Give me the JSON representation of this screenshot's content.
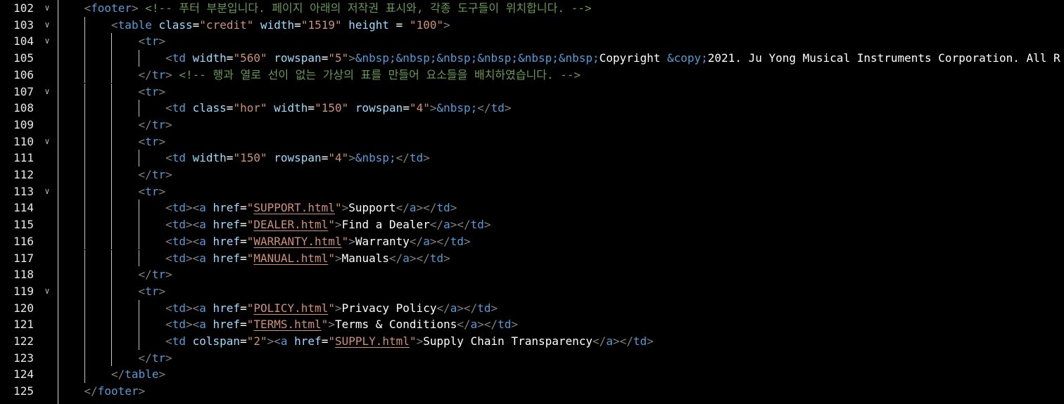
{
  "editor": {
    "colors": {
      "background": "#000000",
      "tag": "#569cd6",
      "attr": "#9cdcfe",
      "string": "#ce9178",
      "comment": "#6a9955",
      "punct": "#808080",
      "text": "#ffffff"
    },
    "lines": [
      {
        "num": "102",
        "fold": true,
        "indent": 1,
        "tokens": [
          [
            "punc",
            "<"
          ],
          [
            "tag",
            "footer"
          ],
          [
            "punc",
            ">"
          ],
          [
            "text",
            " "
          ],
          [
            "com",
            "<!-- 푸터 부분입니다. 페이지 아래의 저작권 표시와, 각종 도구들이 위치합니다. -->"
          ]
        ]
      },
      {
        "num": "103",
        "fold": true,
        "indent": 2,
        "tokens": [
          [
            "punc",
            "<"
          ],
          [
            "tag",
            "table"
          ],
          [
            "text",
            " "
          ],
          [
            "attr",
            "class"
          ],
          [
            "text",
            "="
          ],
          [
            "str",
            "\"credit\""
          ],
          [
            "text",
            " "
          ],
          [
            "attr",
            "width"
          ],
          [
            "text",
            "="
          ],
          [
            "str",
            "\"1519\""
          ],
          [
            "text",
            " "
          ],
          [
            "attr",
            "height"
          ],
          [
            "text",
            " = "
          ],
          [
            "str",
            "\"100\""
          ],
          [
            "punc",
            ">"
          ]
        ]
      },
      {
        "num": "104",
        "fold": true,
        "indent": 3,
        "tokens": [
          [
            "punc",
            "<"
          ],
          [
            "tag",
            "tr"
          ],
          [
            "punc",
            ">"
          ]
        ]
      },
      {
        "num": "105",
        "fold": false,
        "indent": 4,
        "tokens": [
          [
            "punc",
            "<"
          ],
          [
            "tag",
            "td"
          ],
          [
            "text",
            " "
          ],
          [
            "attr",
            "width"
          ],
          [
            "text",
            "="
          ],
          [
            "str",
            "\"560\""
          ],
          [
            "text",
            " "
          ],
          [
            "attr",
            "rowspan"
          ],
          [
            "text",
            "="
          ],
          [
            "str",
            "\"5\""
          ],
          [
            "punc",
            ">"
          ],
          [
            "ent",
            "&nbsp;&nbsp;&nbsp;&nbsp;&nbsp;&nbsp;"
          ],
          [
            "text",
            "Copyright "
          ],
          [
            "ent",
            "&copy;"
          ],
          [
            "text",
            "2021. Ju Yong Musical Instruments Corporation. All R"
          ]
        ]
      },
      {
        "num": "106",
        "fold": false,
        "indent": 3,
        "tokens": [
          [
            "punc",
            "</"
          ],
          [
            "tag",
            "tr"
          ],
          [
            "punc",
            ">"
          ],
          [
            "text",
            " "
          ],
          [
            "com",
            "<!-- 행과 열로 선이 없는 가상의 표를 만들어 요소들을 배치하였습니다. -->"
          ]
        ]
      },
      {
        "num": "107",
        "fold": true,
        "indent": 3,
        "tokens": [
          [
            "punc",
            "<"
          ],
          [
            "tag",
            "tr"
          ],
          [
            "punc",
            ">"
          ]
        ]
      },
      {
        "num": "108",
        "fold": false,
        "indent": 4,
        "tokens": [
          [
            "punc",
            "<"
          ],
          [
            "tag",
            "td"
          ],
          [
            "text",
            " "
          ],
          [
            "attr",
            "class"
          ],
          [
            "text",
            "="
          ],
          [
            "str",
            "\"hor\""
          ],
          [
            "text",
            " "
          ],
          [
            "attr",
            "width"
          ],
          [
            "text",
            "="
          ],
          [
            "str",
            "\"150\""
          ],
          [
            "text",
            " "
          ],
          [
            "attr",
            "rowspan"
          ],
          [
            "text",
            "="
          ],
          [
            "str",
            "\"4\""
          ],
          [
            "punc",
            ">"
          ],
          [
            "ent",
            "&nbsp;"
          ],
          [
            "punc",
            "</"
          ],
          [
            "tag",
            "td"
          ],
          [
            "punc",
            ">"
          ]
        ]
      },
      {
        "num": "109",
        "fold": false,
        "indent": 3,
        "tokens": [
          [
            "punc",
            "</"
          ],
          [
            "tag",
            "tr"
          ],
          [
            "punc",
            ">"
          ]
        ]
      },
      {
        "num": "110",
        "fold": true,
        "indent": 3,
        "tokens": [
          [
            "punc",
            "<"
          ],
          [
            "tag",
            "tr"
          ],
          [
            "punc",
            ">"
          ]
        ]
      },
      {
        "num": "111",
        "fold": false,
        "indent": 4,
        "tokens": [
          [
            "punc",
            "<"
          ],
          [
            "tag",
            "td"
          ],
          [
            "text",
            " "
          ],
          [
            "attr",
            "width"
          ],
          [
            "text",
            "="
          ],
          [
            "str",
            "\"150\""
          ],
          [
            "text",
            " "
          ],
          [
            "attr",
            "rowspan"
          ],
          [
            "text",
            "="
          ],
          [
            "str",
            "\"4\""
          ],
          [
            "punc",
            ">"
          ],
          [
            "ent",
            "&nbsp;"
          ],
          [
            "punc",
            "</"
          ],
          [
            "tag",
            "td"
          ],
          [
            "punc",
            ">"
          ]
        ]
      },
      {
        "num": "112",
        "fold": false,
        "indent": 3,
        "tokens": [
          [
            "punc",
            "</"
          ],
          [
            "tag",
            "tr"
          ],
          [
            "punc",
            ">"
          ]
        ]
      },
      {
        "num": "113",
        "fold": true,
        "indent": 3,
        "tokens": [
          [
            "punc",
            "<"
          ],
          [
            "tag",
            "tr"
          ],
          [
            "punc",
            ">"
          ]
        ]
      },
      {
        "num": "114",
        "fold": false,
        "indent": 4,
        "tokens": [
          [
            "punc",
            "<"
          ],
          [
            "tag",
            "td"
          ],
          [
            "punc",
            "><"
          ],
          [
            "tag",
            "a"
          ],
          [
            "text",
            " "
          ],
          [
            "attr",
            "href"
          ],
          [
            "text",
            "="
          ],
          [
            "str",
            "\""
          ],
          [
            "link",
            "SUPPORT.html"
          ],
          [
            "str",
            "\""
          ],
          [
            "punc",
            ">"
          ],
          [
            "text",
            "Support"
          ],
          [
            "punc",
            "</"
          ],
          [
            "tag",
            "a"
          ],
          [
            "punc",
            "></"
          ],
          [
            "tag",
            "td"
          ],
          [
            "punc",
            ">"
          ]
        ]
      },
      {
        "num": "115",
        "fold": false,
        "indent": 4,
        "tokens": [
          [
            "punc",
            "<"
          ],
          [
            "tag",
            "td"
          ],
          [
            "punc",
            "><"
          ],
          [
            "tag",
            "a"
          ],
          [
            "text",
            " "
          ],
          [
            "attr",
            "href"
          ],
          [
            "text",
            "="
          ],
          [
            "str",
            "\""
          ],
          [
            "link",
            "DEALER.html"
          ],
          [
            "str",
            "\""
          ],
          [
            "punc",
            ">"
          ],
          [
            "text",
            "Find a Dealer"
          ],
          [
            "punc",
            "</"
          ],
          [
            "tag",
            "a"
          ],
          [
            "punc",
            "></"
          ],
          [
            "tag",
            "td"
          ],
          [
            "punc",
            ">"
          ]
        ]
      },
      {
        "num": "116",
        "fold": false,
        "indent": 4,
        "tokens": [
          [
            "punc",
            "<"
          ],
          [
            "tag",
            "td"
          ],
          [
            "punc",
            "><"
          ],
          [
            "tag",
            "a"
          ],
          [
            "text",
            " "
          ],
          [
            "attr",
            "href"
          ],
          [
            "text",
            "="
          ],
          [
            "str",
            "\""
          ],
          [
            "link",
            "WARRANTY.html"
          ],
          [
            "str",
            "\""
          ],
          [
            "punc",
            ">"
          ],
          [
            "text",
            "Warranty"
          ],
          [
            "punc",
            "</"
          ],
          [
            "tag",
            "a"
          ],
          [
            "punc",
            "></"
          ],
          [
            "tag",
            "td"
          ],
          [
            "punc",
            ">"
          ]
        ]
      },
      {
        "num": "117",
        "fold": false,
        "indent": 4,
        "tokens": [
          [
            "punc",
            "<"
          ],
          [
            "tag",
            "td"
          ],
          [
            "punc",
            "><"
          ],
          [
            "tag",
            "a"
          ],
          [
            "text",
            " "
          ],
          [
            "attr",
            "href"
          ],
          [
            "text",
            "="
          ],
          [
            "str",
            "\""
          ],
          [
            "link",
            "MANUAL.html"
          ],
          [
            "str",
            "\""
          ],
          [
            "punc",
            ">"
          ],
          [
            "text",
            "Manuals"
          ],
          [
            "punc",
            "</"
          ],
          [
            "tag",
            "a"
          ],
          [
            "punc",
            "></"
          ],
          [
            "tag",
            "td"
          ],
          [
            "punc",
            ">"
          ]
        ]
      },
      {
        "num": "118",
        "fold": false,
        "indent": 3,
        "tokens": [
          [
            "punc",
            "</"
          ],
          [
            "tag",
            "tr"
          ],
          [
            "punc",
            ">"
          ]
        ]
      },
      {
        "num": "119",
        "fold": true,
        "indent": 3,
        "tokens": [
          [
            "punc",
            "<"
          ],
          [
            "tag",
            "tr"
          ],
          [
            "punc",
            ">"
          ]
        ]
      },
      {
        "num": "120",
        "fold": false,
        "indent": 4,
        "tokens": [
          [
            "punc",
            "<"
          ],
          [
            "tag",
            "td"
          ],
          [
            "punc",
            "><"
          ],
          [
            "tag",
            "a"
          ],
          [
            "text",
            " "
          ],
          [
            "attr",
            "href"
          ],
          [
            "text",
            "="
          ],
          [
            "str",
            "\""
          ],
          [
            "link",
            "POLICY.html"
          ],
          [
            "str",
            "\""
          ],
          [
            "punc",
            ">"
          ],
          [
            "text",
            "Privacy Policy"
          ],
          [
            "punc",
            "</"
          ],
          [
            "tag",
            "a"
          ],
          [
            "punc",
            "></"
          ],
          [
            "tag",
            "td"
          ],
          [
            "punc",
            ">"
          ]
        ]
      },
      {
        "num": "121",
        "fold": false,
        "indent": 4,
        "tokens": [
          [
            "punc",
            "<"
          ],
          [
            "tag",
            "td"
          ],
          [
            "punc",
            "><"
          ],
          [
            "tag",
            "a"
          ],
          [
            "text",
            " "
          ],
          [
            "attr",
            "href"
          ],
          [
            "text",
            "="
          ],
          [
            "str",
            "\""
          ],
          [
            "link",
            "TERMS.html"
          ],
          [
            "str",
            "\""
          ],
          [
            "punc",
            ">"
          ],
          [
            "text",
            "Terms & Conditions"
          ],
          [
            "punc",
            "</"
          ],
          [
            "tag",
            "a"
          ],
          [
            "punc",
            "></"
          ],
          [
            "tag",
            "td"
          ],
          [
            "punc",
            ">"
          ]
        ]
      },
      {
        "num": "122",
        "fold": false,
        "indent": 4,
        "tokens": [
          [
            "punc",
            "<"
          ],
          [
            "tag",
            "td"
          ],
          [
            "text",
            " "
          ],
          [
            "attr",
            "colspan"
          ],
          [
            "text",
            "="
          ],
          [
            "str",
            "\"2\""
          ],
          [
            "punc",
            "><"
          ],
          [
            "tag",
            "a"
          ],
          [
            "text",
            " "
          ],
          [
            "attr",
            "href"
          ],
          [
            "text",
            "="
          ],
          [
            "str",
            "\""
          ],
          [
            "link",
            "SUPPLY.html"
          ],
          [
            "str",
            "\""
          ],
          [
            "punc",
            ">"
          ],
          [
            "text",
            "Supply Chain Transparency"
          ],
          [
            "punc",
            "</"
          ],
          [
            "tag",
            "a"
          ],
          [
            "punc",
            "></"
          ],
          [
            "tag",
            "td"
          ],
          [
            "punc",
            ">"
          ]
        ]
      },
      {
        "num": "123",
        "fold": false,
        "indent": 3,
        "tokens": [
          [
            "punc",
            "</"
          ],
          [
            "tag",
            "tr"
          ],
          [
            "punc",
            ">"
          ]
        ]
      },
      {
        "num": "124",
        "fold": false,
        "indent": 2,
        "tokens": [
          [
            "punc",
            "</"
          ],
          [
            "tag",
            "table"
          ],
          [
            "punc",
            ">"
          ]
        ]
      },
      {
        "num": "125",
        "fold": false,
        "indent": 1,
        "tokens": [
          [
            "punc",
            "</"
          ],
          [
            "tag",
            "footer"
          ],
          [
            "punc",
            ">"
          ]
        ]
      }
    ]
  }
}
